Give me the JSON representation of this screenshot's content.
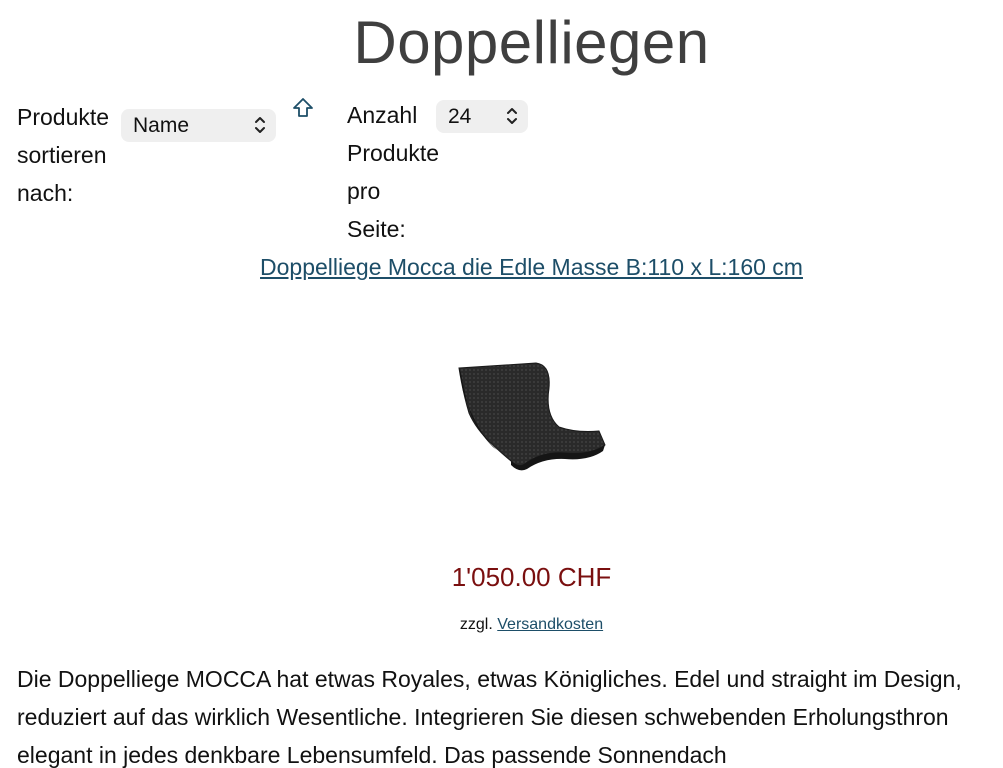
{
  "page": {
    "title": "Doppelliegen"
  },
  "sort": {
    "label": "Produkte sortieren nach:",
    "selected": "Name",
    "direction_icon": "arrow-up-icon"
  },
  "per_page": {
    "label": "Anzahl Produkte pro Seite:",
    "selected": "24"
  },
  "product": {
    "link_text": "Doppelliege Mocca die Edle Masse B:110 x L:160 cm",
    "price": "1'050.00 CHF",
    "shipping_prefix": "zzgl.",
    "shipping_link": "Versandkosten",
    "description": "Die Doppelliege MOCCA hat etwas Royales, etwas Königliches. Edel und straight im Design, reduziert auf das wirklich Wesentliche. Integrieren Sie diesen schwebenden Erholungsthron elegant in jedes denkbare Lebensumfeld. Das passende Sonnendach"
  },
  "colors": {
    "link": "#1d4e68",
    "price": "#7a0f0f",
    "title": "#3f3f3f"
  }
}
